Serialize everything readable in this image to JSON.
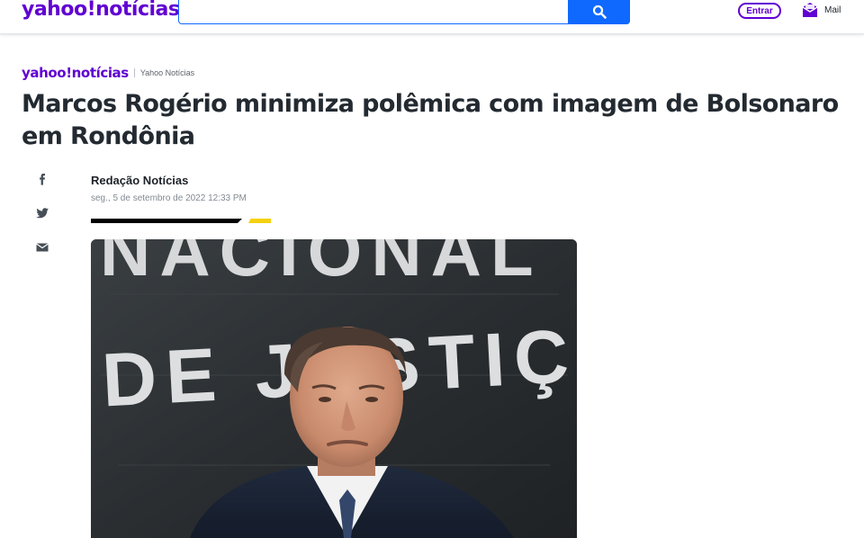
{
  "header": {
    "logo_text": "yahoo!notícias",
    "search": {
      "value": "",
      "placeholder": ""
    },
    "signin_label": "Entrar",
    "mail_label": "Mail"
  },
  "article": {
    "provider_logo": "yahoo!notícias",
    "provider_name": "Yahoo Notícias",
    "title": "Marcos Rogério minimiza polêmica com imagem de Bolsonaro em Rondônia",
    "author": "Redação Notícias",
    "date": "seg., 5 de setembro de 2022 12:33 PM",
    "share": [
      "facebook-icon",
      "twitter-icon",
      "email-icon"
    ],
    "photo": {
      "background_text_line1": "NACIONAL",
      "background_text_line2": "DE JUSTIÇA"
    }
  },
  "colors": {
    "brand": "#6001d2",
    "search_blue": "#0f69ff",
    "accent_yellow": "#f5d10c"
  }
}
